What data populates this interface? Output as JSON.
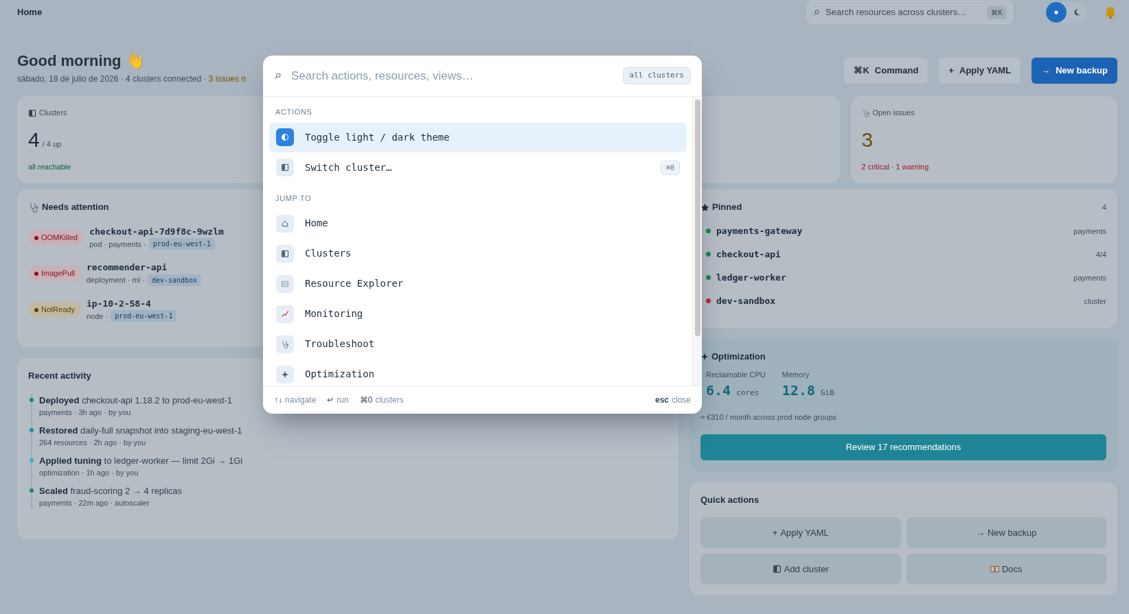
{
  "topbar": {
    "breadcrumb": "Home",
    "search": {
      "placeholder": "Search resources across clusters…",
      "shortcut": "⌘K"
    },
    "theme_modes": [
      {
        "kind": "light",
        "selected": true
      },
      {
        "kind": "dark",
        "selected": false
      }
    ]
  },
  "header": {
    "title": "Good morning 👋",
    "subtitle": "sábado, 18 de julio de 2026 · 4 clusters connected · ",
    "subtitle_alert": "3 issues n"
  },
  "actions": [
    {
      "glyph": "⌘K",
      "label": "Command",
      "kind": "light"
    },
    {
      "glyph": "+",
      "label": "Apply YAML",
      "kind": "light"
    },
    {
      "glyph": "→",
      "label": "New backup",
      "kind": "primary"
    }
  ],
  "stats": [
    {
      "kind": "clusters",
      "label": "Clusters",
      "value": "4",
      "suffix": "/ 4 up",
      "note": "all reachable"
    },
    {
      "kind": "issues",
      "label": "Open issues",
      "value": "3",
      "note": "2 critical · 1 warning"
    }
  ],
  "needs_attention": {
    "title": "Needs attention",
    "items": [
      {
        "status": "OOMKilled",
        "kind": "critical",
        "name": "checkout-api-7d9f8c-9wzlm",
        "meta": "pod · payments ·",
        "cluster": "prod-eu-west-1"
      },
      {
        "status": "ImagePull",
        "kind": "critical",
        "name": "recommender-api",
        "meta": "deployment · ml ·",
        "cluster": "dev-sandbox"
      },
      {
        "status": "NotReady",
        "kind": "warning",
        "name": "ip-10-2-58-4",
        "meta": "node ·",
        "cluster": "prod-eu-west-1"
      }
    ]
  },
  "recent_activity": {
    "title": "Recent activity",
    "items": [
      {
        "action": "Deployed",
        "detail": " checkout-api 1.18.2 to prod-eu-west-1",
        "meta": "payments · 3h ago · by you",
        "color": "#198754"
      },
      {
        "action": "Restored",
        "detail": " daily-full snapshot into staging-eu-west-1",
        "meta": "264 resources · 2h ago · by you",
        "color": "#1f8fa8"
      },
      {
        "action": "Applied tuning",
        "detail": " to ledger-worker — limit 2Gi → 1Gi",
        "meta": "optimization · 1h ago · by you",
        "color": "#2bb3c7"
      },
      {
        "action": "Scaled",
        "detail": " fraud-scoring 2 → 4 replicas",
        "meta": "payments · 22m ago · autoscaler",
        "color": "#198754"
      }
    ]
  },
  "pinned": {
    "title": "Pinned",
    "count": "4",
    "items": [
      {
        "name": "payments-gateway",
        "tag": "payments",
        "color": "#198754"
      },
      {
        "name": "checkout-api",
        "tag": "4/4",
        "color": "#198754"
      },
      {
        "name": "ledger-worker",
        "tag": "payments",
        "color": "#198754"
      },
      {
        "name": "dev-sandbox",
        "tag": "cluster",
        "color": "#c0283a"
      }
    ]
  },
  "optimization": {
    "title": "Optimization",
    "metrics": [
      {
        "label": "Reclaimable CPU",
        "value": "6.4",
        "unit": "cores"
      },
      {
        "label": "Memory",
        "value": "12.8",
        "unit": "GiB"
      }
    ],
    "note": "≈ €310 / month across prod node groups",
    "button": "Review 17 recommendations"
  },
  "quick_actions": {
    "title": "Quick actions",
    "buttons": [
      {
        "glyph": "+",
        "label": "Apply YAML"
      },
      {
        "glyph": "→",
        "label": "New backup"
      },
      {
        "kind": "cluster",
        "label": "Add cluster"
      },
      {
        "kind": "docs",
        "label": "Docs"
      }
    ]
  },
  "palette": {
    "search": {
      "placeholder": "Search actions, resources, views…"
    },
    "scope": "all clusters",
    "sections": [
      {
        "title": "ACTIONS",
        "items": [
          {
            "label": "Toggle light / dark theme",
            "kind": "theme",
            "selected": true
          },
          {
            "label": "Switch cluster…",
            "kind": "cluster",
            "shortcut": "⌘0",
            "selected": false
          }
        ]
      },
      {
        "title": "JUMP TO",
        "items": [
          {
            "label": "Home",
            "kind": "home",
            "selected": false
          },
          {
            "label": "Clusters",
            "kind": "cluster",
            "selected": false
          },
          {
            "label": "Resource Explorer",
            "kind": "explorer",
            "selected": false
          },
          {
            "label": "Monitoring",
            "kind": "monitoring",
            "selected": false
          },
          {
            "label": "Troubleshoot",
            "kind": "troubleshoot",
            "selected": false
          },
          {
            "label": "Optimization",
            "kind": "optimization",
            "selected": false
          }
        ]
      }
    ],
    "hints": [
      {
        "key": "↑↓",
        "label": "navigate"
      },
      {
        "key": "↵",
        "label": "run"
      },
      {
        "key": "⌘0",
        "label": "clusters"
      }
    ],
    "close_hint": {
      "key": "esc",
      "label": "close"
    }
  }
}
